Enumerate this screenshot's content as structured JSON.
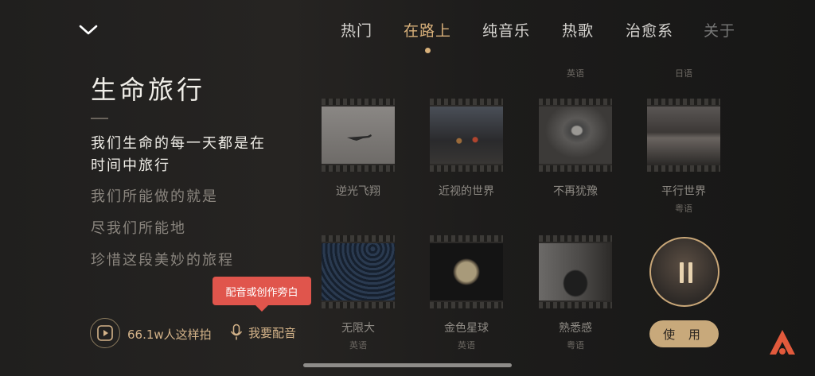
{
  "tabs": [
    {
      "label": "热门"
    },
    {
      "label": "在路上"
    },
    {
      "label": "纯音乐"
    },
    {
      "label": "热歌"
    },
    {
      "label": "治愈系"
    },
    {
      "label": "关于"
    }
  ],
  "active_tab": "在路上",
  "template": {
    "title": "生命旅行",
    "lyrics": [
      "我们生命的每一天都是在",
      "时间中旅行",
      "我们所能做的就是",
      "尽我们所能地",
      "珍惜这段美妙的旅程"
    ]
  },
  "tooltip": "配音或创作旁白",
  "footer": {
    "count": "66.1w人这样拍",
    "dub_label": "我要配音"
  },
  "top_row": [
    {
      "lang": "英语"
    },
    {
      "lang": "日语"
    }
  ],
  "row1": [
    {
      "name": "逆光飞翔",
      "lang": ""
    },
    {
      "name": "近视的世界",
      "lang": ""
    },
    {
      "name": "不再犹豫",
      "lang": ""
    },
    {
      "name": "平行世界",
      "lang": "粤语"
    }
  ],
  "row2": [
    {
      "name": "无限大",
      "lang": "英语"
    },
    {
      "name": "金色星球",
      "lang": "英语"
    },
    {
      "name": "熟悉感",
      "lang": "粤语"
    }
  ],
  "player": {
    "use_label": "使 用"
  },
  "colors": {
    "accent": "#d8b07a",
    "tooltip": "#e0554c",
    "use_button": "#c8a97b"
  }
}
